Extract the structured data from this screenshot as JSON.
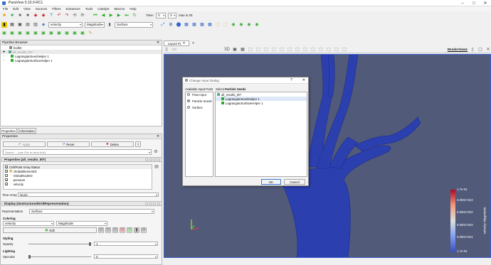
{
  "window": {
    "title": "ParaView 5.10.0-RC1"
  },
  "menu": [
    "File",
    "Edit",
    "View",
    "Sources",
    "Filters",
    "Extractors",
    "Tools",
    "Catalyst",
    "Macros",
    "Help"
  ],
  "toolbar": {
    "time_label": "Time:",
    "time_value": "0",
    "time_index": "0",
    "max_label": "max is 20",
    "array_select": "velocity",
    "component_select": "Magnitude",
    "repr_select": "Surface"
  },
  "pipeline": {
    "title": "Pipeline Browser",
    "items": [
      {
        "label": "builtin:"
      },
      {
        "label": "all_results_00*"
      },
      {
        "label": "LagrangianSeedHelper 1"
      },
      {
        "label": "LagrangianSurfaceHelper 1"
      }
    ]
  },
  "tabs": {
    "properties": "Properties",
    "information": "Information"
  },
  "properties": {
    "title": "Properties",
    "apply": "Apply",
    "reset": "Reset",
    "delete": "Delete",
    "help": "?",
    "search_placeholder": "Search ... (use Esc to clear text)",
    "section_props": "Properties (all_results_00*)",
    "arrays": [
      "Cell/Point Array Status",
      "GlobalElementID",
      "GlobalNodeID",
      "pressure",
      "velocity"
    ],
    "time_array_label": "Time Array",
    "time_array_value": "None",
    "section_display": "Display (UnstructuredGridRepresentation)",
    "representation_label": "Representation",
    "representation_value": "Surface",
    "coloring_label": "Coloring",
    "coloring_array": "velocity",
    "coloring_comp": "Magnitude",
    "edit_label": "Edit",
    "styling_label": "Styling",
    "opacity_label": "Opacity",
    "opacity_value": "1",
    "lighting_label": "Lighting",
    "specular_label": "Specular",
    "specular_value": "0"
  },
  "view": {
    "tab": "Layout #1",
    "tab_close": "✕",
    "tab_add": "+",
    "render_label": "RenderView1"
  },
  "dialog": {
    "title": "Change Input Dialog",
    "help": "?",
    "close": "✕",
    "ports_header": "Available Input Ports",
    "ports": [
      "Flow Input",
      "Particle Seeds",
      "Surface"
    ],
    "select_prefix": "Select",
    "select_target": "Particle Seeds",
    "tree": [
      "all_results_00*",
      "LagrangianSeedHelper 1",
      "LagrangianSurfaceHelper 1"
    ],
    "ok": "OK",
    "cancel": "Cancel"
  },
  "colorbar": {
    "title": "velocity Magnitude",
    "ticks": [
      "1.7e-04",
      "0.00017323",
      "0.00017322",
      "0.00017322",
      "0.00017321",
      "1.7e-04"
    ]
  },
  "colors": {
    "background": "#525a7a",
    "vessel": "#2b3fae",
    "accent": "#3a5fcd"
  }
}
